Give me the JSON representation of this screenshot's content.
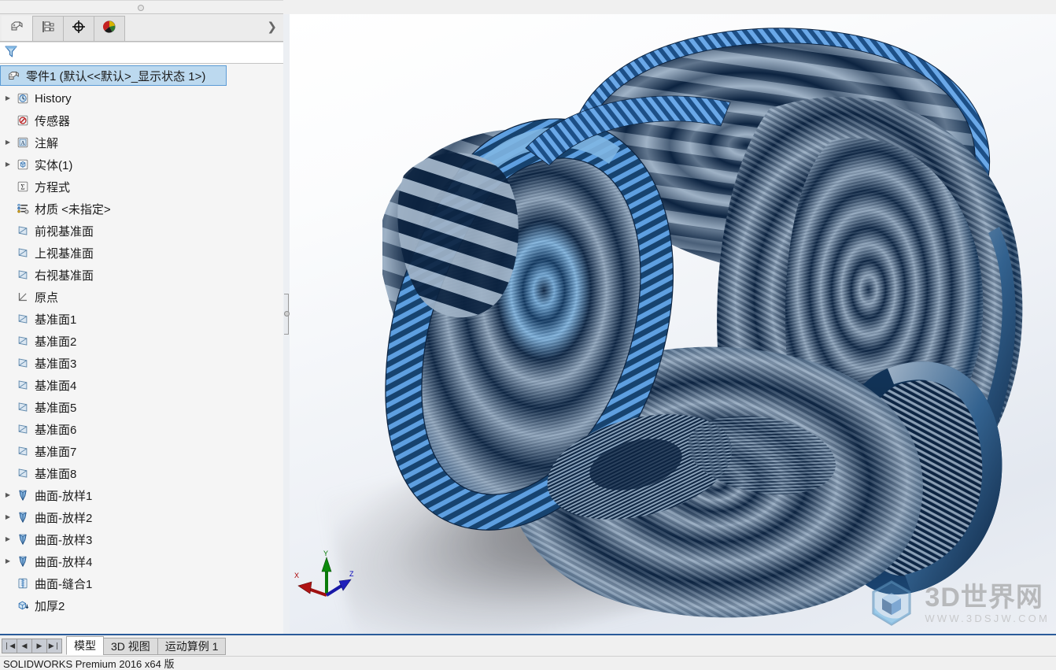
{
  "panel": {
    "tabs": [
      {
        "name": "feature-manager-design-tree",
        "icon": "feature-tree-icon",
        "active": true
      },
      {
        "name": "property-manager",
        "icon": "property-manager-icon",
        "active": false
      },
      {
        "name": "configuration-manager",
        "icon": "configuration-target-icon",
        "active": false
      },
      {
        "name": "display-manager",
        "icon": "display-manager-sphere-icon",
        "active": false
      }
    ],
    "expand_label": "❯",
    "filter": {
      "placeholder": "",
      "value": "",
      "icon": "filter-funnel-icon"
    }
  },
  "tree": {
    "root": {
      "label": "零件1  (默认<<默认>_显示状态 1>)",
      "icon": "part-icon",
      "selected": true
    },
    "items": [
      {
        "label": "History",
        "icon": "history-icon",
        "expandable": true
      },
      {
        "label": "传感器",
        "icon": "sensor-icon",
        "expandable": false
      },
      {
        "label": "注解",
        "icon": "annotations-icon",
        "expandable": true
      },
      {
        "label": "实体(1)",
        "icon": "solid-bodies-icon",
        "expandable": true
      },
      {
        "label": "方程式",
        "icon": "equations-icon",
        "expandable": false
      },
      {
        "label": "材质 <未指定>",
        "icon": "material-icon",
        "expandable": false
      },
      {
        "label": "前视基准面",
        "icon": "plane-icon",
        "expandable": false
      },
      {
        "label": "上视基准面",
        "icon": "plane-icon",
        "expandable": false
      },
      {
        "label": "右视基准面",
        "icon": "plane-icon",
        "expandable": false
      },
      {
        "label": "原点",
        "icon": "origin-icon",
        "expandable": false
      },
      {
        "label": "基准面1",
        "icon": "plane-icon",
        "expandable": false
      },
      {
        "label": "基准面2",
        "icon": "plane-icon",
        "expandable": false
      },
      {
        "label": "基准面3",
        "icon": "plane-icon",
        "expandable": false
      },
      {
        "label": "基准面4",
        "icon": "plane-icon",
        "expandable": false
      },
      {
        "label": "基准面5",
        "icon": "plane-icon",
        "expandable": false
      },
      {
        "label": "基准面6",
        "icon": "plane-icon",
        "expandable": false
      },
      {
        "label": "基准面7",
        "icon": "plane-icon",
        "expandable": false
      },
      {
        "label": "基准面8",
        "icon": "plane-icon",
        "expandable": false
      },
      {
        "label": "曲面-放样1",
        "icon": "lofted-surface-icon",
        "expandable": true
      },
      {
        "label": "曲面-放样2",
        "icon": "lofted-surface-icon",
        "expandable": true
      },
      {
        "label": "曲面-放样3",
        "icon": "lofted-surface-icon",
        "expandable": true
      },
      {
        "label": "曲面-放样4",
        "icon": "lofted-surface-icon",
        "expandable": true
      },
      {
        "label": "曲面-缝合1",
        "icon": "knit-surface-icon",
        "expandable": false
      },
      {
        "label": "加厚2",
        "icon": "thicken-icon",
        "expandable": false
      }
    ]
  },
  "viewport": {
    "triad": {
      "x_label": "X",
      "y_label": "Y",
      "z_label": "Z",
      "x_color": "#aa0000",
      "y_color": "#007700",
      "z_color": "#0000bb"
    },
    "model": {
      "display_mode": "zebra-stripes",
      "stripe_dark": "#0c2340",
      "stripe_light": "#9fb2c6",
      "edge_blue": "#6aa8e8",
      "accent_blue": "#2f6fb0"
    }
  },
  "watermark": {
    "title": "3D世界网",
    "url": "WWW.3DSJW.COM",
    "logo": "hex-cube-logo-icon"
  },
  "bottom": {
    "nav": [
      "❘◀",
      "◀",
      "▶",
      "▶❘"
    ],
    "tabs": [
      {
        "label": "模型",
        "active": true
      },
      {
        "label": "3D 视图",
        "active": false
      },
      {
        "label": "运动算例 1",
        "active": false
      }
    ]
  },
  "status": {
    "text": "SOLIDWORKS Premium 2016 x64 版"
  }
}
